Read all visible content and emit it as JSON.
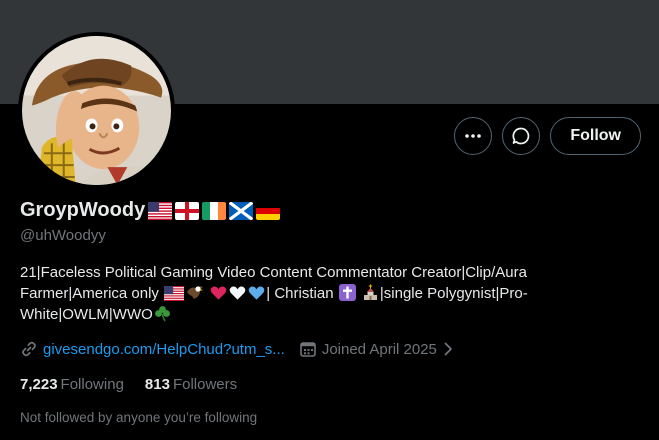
{
  "profile": {
    "display_name": "GroypWoody",
    "name_flags": [
      "us-flag",
      "england-flag",
      "ireland-flag",
      "scotland-flag",
      "germany-flag"
    ],
    "handle": "@uhWoodyy",
    "bio": {
      "line1": "21|Faceless Political Gaming Video Content Commentator Creator|Clip/Aura",
      "line2a": "Farmer|America only",
      "line2b": "| Christian",
      "line2c": "|single Polygynist|Pro-",
      "line3": "White|OWLM|WWO"
    },
    "link": "givesendgo.com/HelpChud?utm_s...",
    "joined": "Joined April 2025",
    "following_count": "7,223",
    "following_label": "Following",
    "followers_count": "813",
    "followers_label": "Followers",
    "not_followed_text": "Not followed by anyone you’re following"
  },
  "actions": {
    "more_icon": "more-icon",
    "message_icon": "message-icon",
    "follow_label": "Follow"
  },
  "colors": {
    "background": "#000000",
    "banner": "#333639",
    "text_primary": "#e7e9ea",
    "text_secondary": "#71767b",
    "link": "#1d9bf0",
    "button_border": "#536471"
  }
}
